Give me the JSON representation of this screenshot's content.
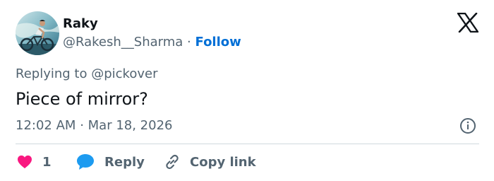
{
  "tweet": {
    "author": {
      "display_name": "Raky",
      "handle": "@Rakesh__Sharma",
      "separator": "·",
      "follow_label": "Follow",
      "avatar_icon": "cyclist-avatar"
    },
    "brand_logo_icon": "x-logo-icon",
    "replying_to": {
      "prefix": "Replying to",
      "mention": "@pickover"
    },
    "text": "Piece of mirror?",
    "time": "12:02 AM",
    "meta_separator": "·",
    "date": "Mar 18, 2026",
    "info_icon": "info-icon",
    "actions": {
      "like": {
        "icon": "heart-icon",
        "count": "1"
      },
      "reply": {
        "icon": "speech-bubble-icon",
        "label": "Reply"
      },
      "copy_link": {
        "icon": "link-icon",
        "label": "Copy link"
      }
    }
  },
  "colors": {
    "text_primary": "#0f1419",
    "text_secondary": "#536471",
    "follow_blue": "#006fd6",
    "like_pink": "#f91880",
    "reply_blue": "#1d9bf0",
    "divider": "#cfd9de"
  }
}
